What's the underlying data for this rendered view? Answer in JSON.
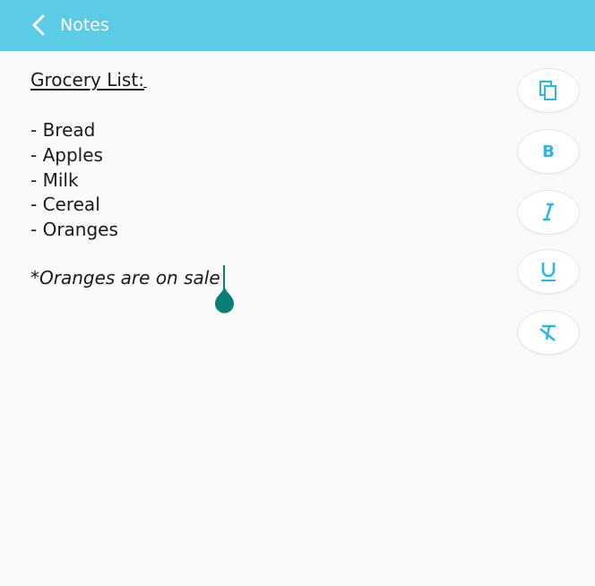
{
  "header": {
    "title": "Notes",
    "back_icon": "chevron-left-icon",
    "background": "#5bcbe6"
  },
  "note": {
    "heading": "Grocery List:",
    "items": [
      "- Bread",
      "- Apples",
      "- Milk",
      "- Cereal",
      "- Oranges"
    ],
    "footnote_mark": "*",
    "footnote": "Oranges are on sale"
  },
  "toolbar": {
    "buttons": [
      {
        "name": "copy",
        "icon": "copy-icon"
      },
      {
        "name": "bold",
        "icon": "bold-icon"
      },
      {
        "name": "italic",
        "icon": "italic-icon"
      },
      {
        "name": "underline",
        "icon": "underline-icon"
      },
      {
        "name": "clear-format",
        "icon": "clear-format-icon"
      }
    ],
    "accent": "#29b6e8"
  },
  "cursor": {
    "color": "#0a7f73"
  }
}
